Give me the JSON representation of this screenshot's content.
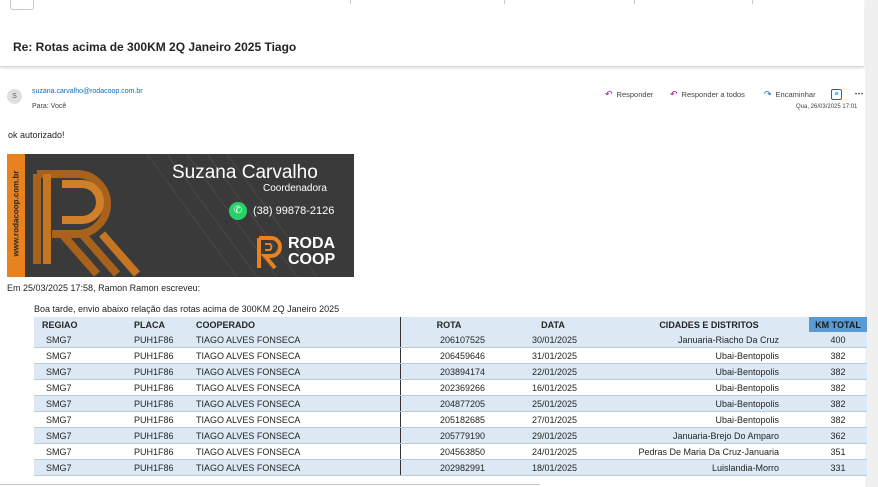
{
  "email": {
    "subject": "Re: Rotas acima de 300KM 2Q Janeiro 2025 Tiago",
    "avatar_initial": "S",
    "sender": "suzana.carvalho@rodacoop.com.br",
    "to": "Para:  Você",
    "actions": {
      "reply": "Responder",
      "reply_all": "Responder a todos",
      "forward": "Encaminhar"
    },
    "icons": {
      "reply": "reply-icon",
      "reply_all": "reply-all-icon",
      "forward": "forward-icon",
      "view": "grid-view-icon",
      "more": "more-icon"
    },
    "date": "Qua, 26/03/2025 17:01",
    "body": "ok autorizado!"
  },
  "signature": {
    "name": "Suzana Carvalho",
    "role": "Coordenadora",
    "phone": "(38) 99878-2126",
    "website": "www.rodacoop.com.br",
    "logo_line1": "RODA",
    "logo_line2": "COOP",
    "colors": {
      "background": "#3b3a3a",
      "accent": "#e8821f",
      "whatsapp": "#25d366"
    }
  },
  "quote": {
    "header": "Em 25/03/2025 17:58, Ramon Ramon escreveu:",
    "intro": "Boa tarde, envio abaixo relação das rotas acima de  300KM 2Q Janeiro 2025"
  },
  "table": {
    "headers": [
      "REGIAO",
      "PLACA",
      "COOPERADO",
      "ROTA",
      "DATA",
      "CIDADES E DISTRITOS",
      "KM TOTAL"
    ],
    "rows": [
      [
        "SMG7",
        "PUH1F86",
        "TIAGO ALVES FONSECA",
        "206107525",
        "30/01/2025",
        "Januaria-Riacho Da Cruz",
        "400"
      ],
      [
        "SMG7",
        "PUH1F86",
        "TIAGO ALVES FONSECA",
        "206459646",
        "31/01/2025",
        "Ubai-Bentopolis",
        "382"
      ],
      [
        "SMG7",
        "PUH1F86",
        "TIAGO ALVES FONSECA",
        "203894174",
        "22/01/2025",
        "Ubai-Bentopolis",
        "382"
      ],
      [
        "SMG7",
        "PUH1F86",
        "TIAGO ALVES FONSECA",
        "202369266",
        "16/01/2025",
        "Ubai-Bentopolis",
        "382"
      ],
      [
        "SMG7",
        "PUH1F86",
        "TIAGO ALVES FONSECA",
        "204877205",
        "25/01/2025",
        "Ubai-Bentopolis",
        "382"
      ],
      [
        "SMG7",
        "PUH1F86",
        "TIAGO ALVES FONSECA",
        "205182685",
        "27/01/2025",
        "Ubai-Bentopolis",
        "382"
      ],
      [
        "SMG7",
        "PUH1F86",
        "TIAGO ALVES FONSECA",
        "205779190",
        "29/01/2025",
        "Januaria-Brejo Do Amparo",
        "362"
      ],
      [
        "SMG7",
        "PUH1F86",
        "TIAGO ALVES FONSECA",
        "204563850",
        "24/01/2025",
        "Pedras De Maria Da Cruz-Januaria",
        "351"
      ],
      [
        "SMG7",
        "PUH1F86",
        "TIAGO ALVES FONSECA",
        "202982991",
        "18/01/2025",
        "Luislandia-Morro",
        "331"
      ]
    ]
  }
}
